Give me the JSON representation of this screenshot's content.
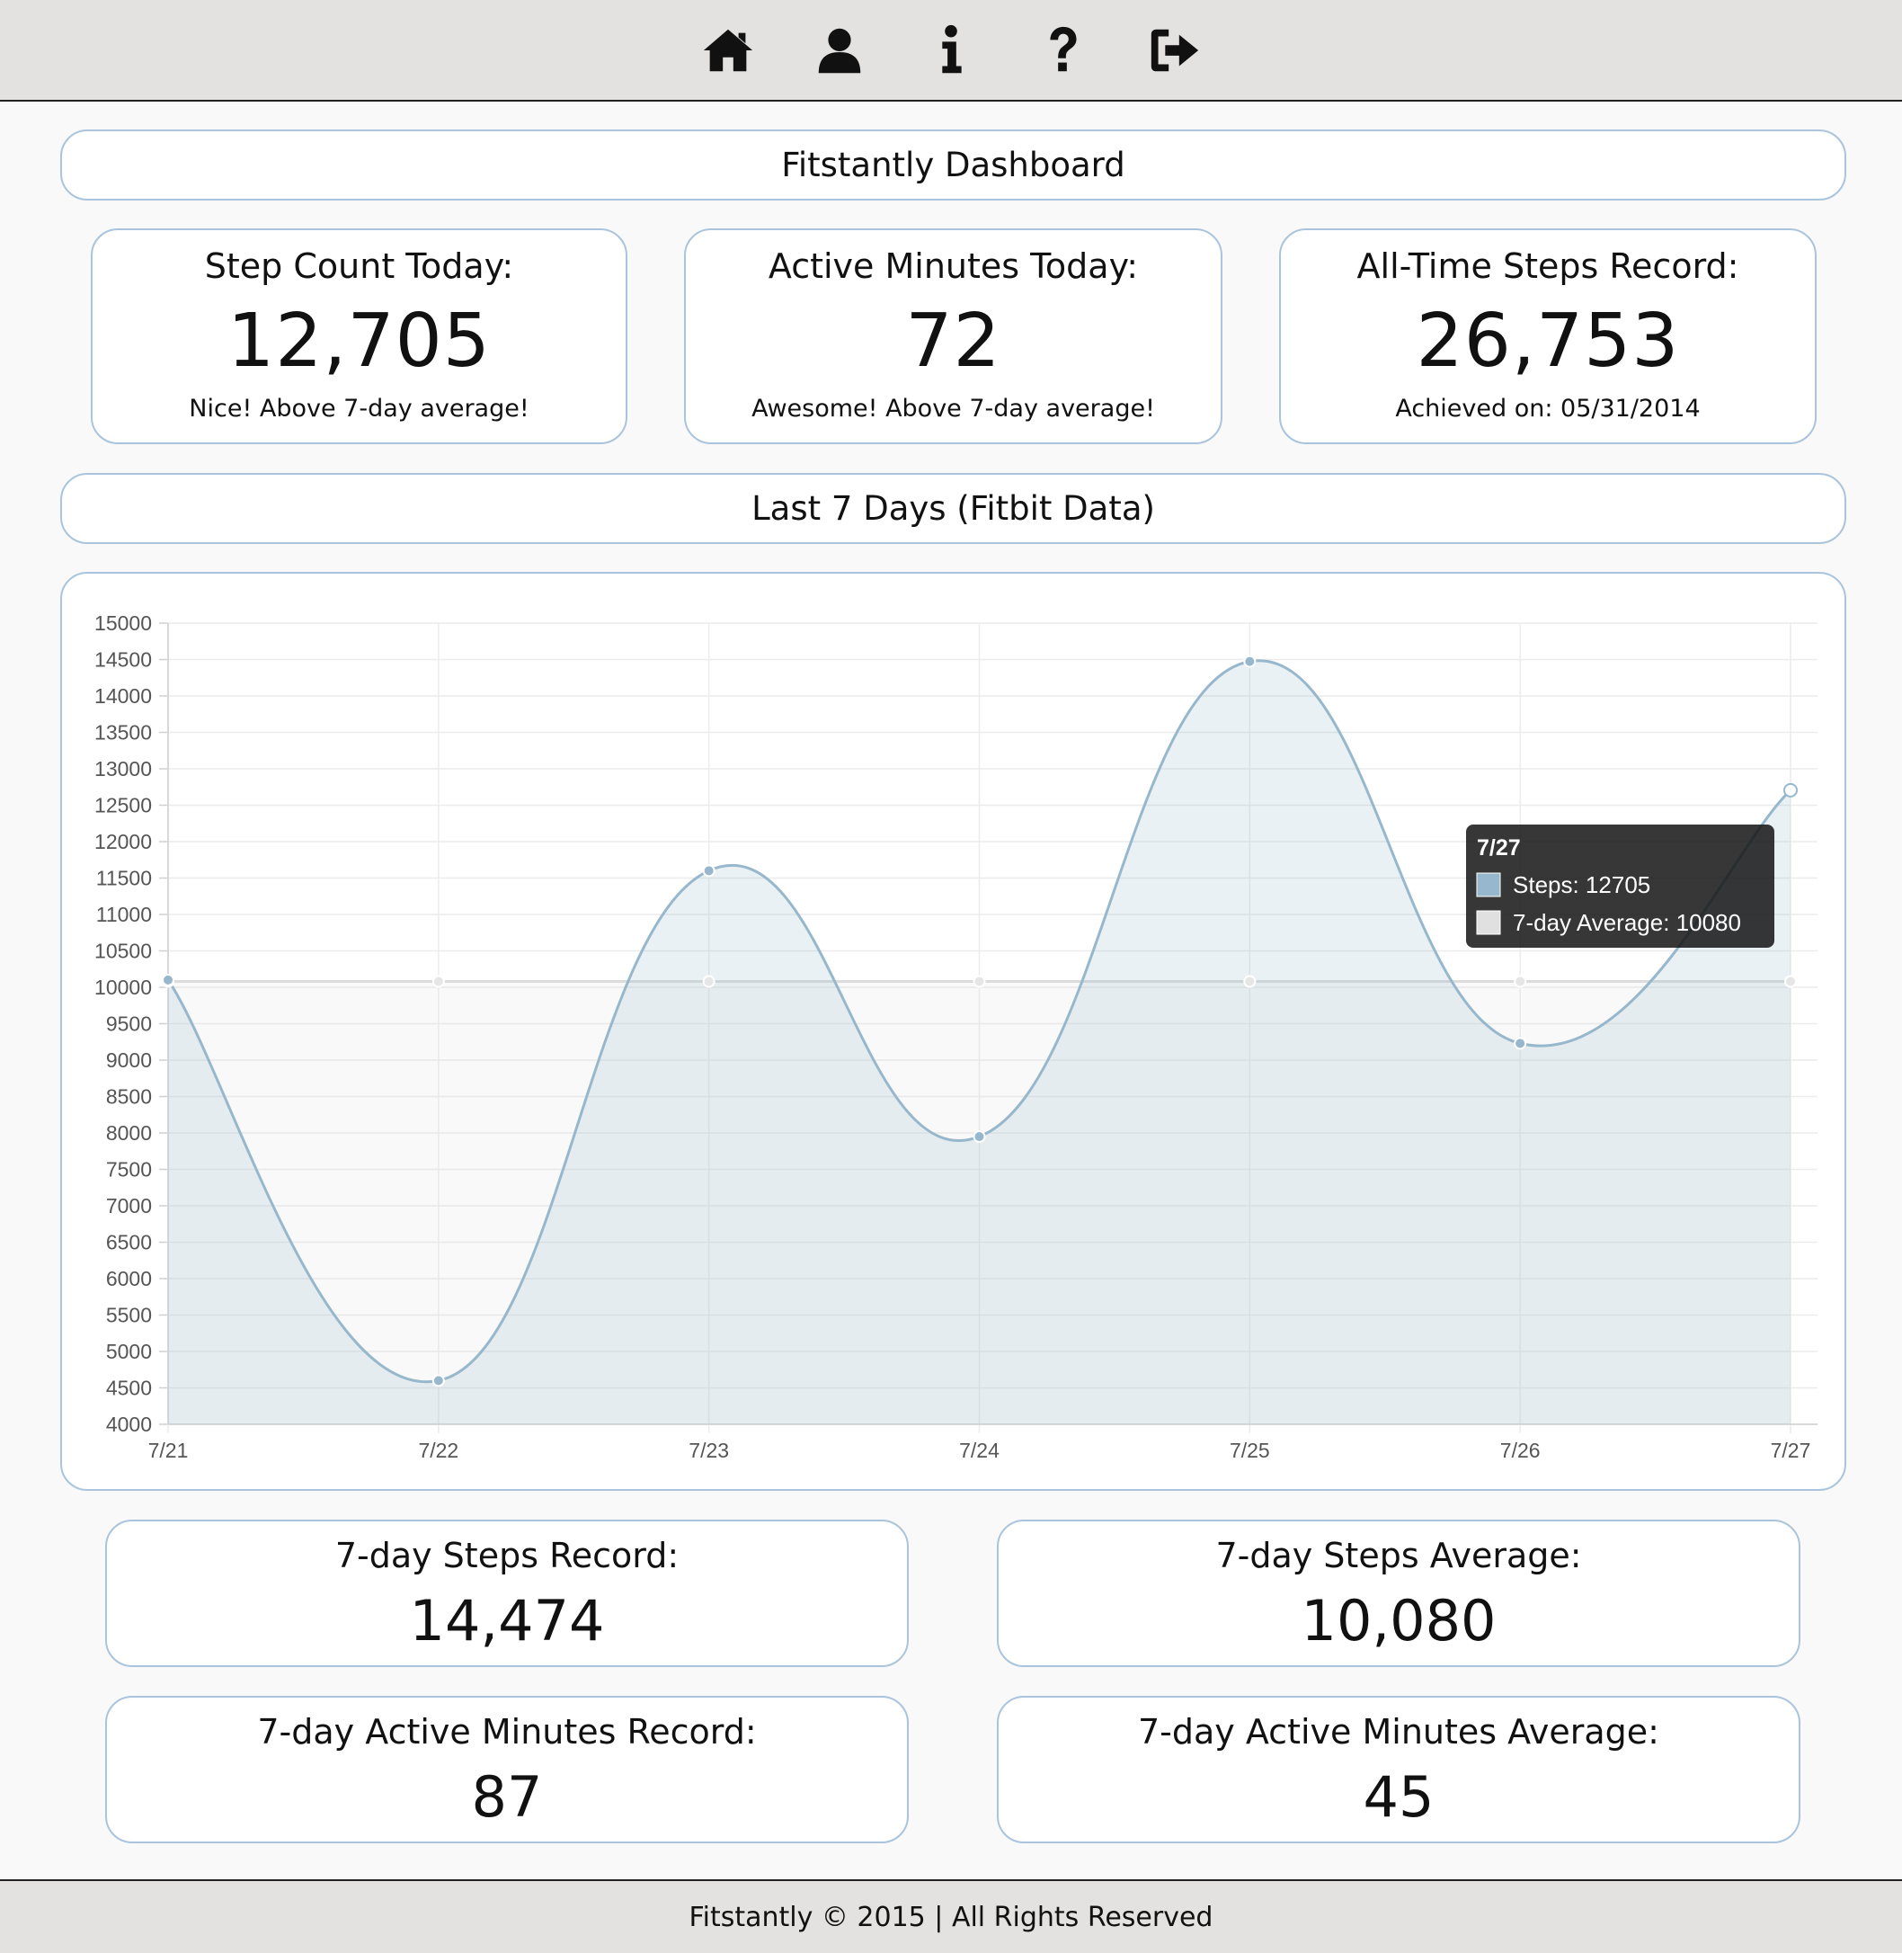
{
  "nav": {
    "icons": [
      "home-icon",
      "user-icon",
      "info-icon",
      "help-icon",
      "logout-icon"
    ]
  },
  "dashboard": {
    "title": "Fitstantly Dashboard"
  },
  "stats": [
    {
      "title": "Step Count Today:",
      "value": "12,705",
      "note": "Nice! Above 7-day average!"
    },
    {
      "title": "Active Minutes Today:",
      "value": "72",
      "note": "Awesome! Above 7-day average!"
    },
    {
      "title": "All-Time Steps Record:",
      "value": "26,753",
      "note": "Achieved on: 05/31/2014"
    }
  ],
  "chart_section": {
    "title": "Last 7 Days (Fitbit Data)"
  },
  "chart_data": {
    "type": "area",
    "categories": [
      "7/21",
      "7/22",
      "7/23",
      "7/24",
      "7/25",
      "7/26",
      "7/27"
    ],
    "series": [
      {
        "name": "Steps",
        "values": [
          10100,
          4600,
          11600,
          7950,
          14474,
          9230,
          12705
        ],
        "color": "#97b8cc"
      },
      {
        "name": "7-day Average",
        "values": [
          10080,
          10080,
          10080,
          10080,
          10080,
          10080,
          10080
        ],
        "color": "#dcdcdc"
      }
    ],
    "ylim": [
      4000,
      15000
    ],
    "yticks": [
      4000,
      4500,
      5000,
      5500,
      6000,
      6500,
      7000,
      7500,
      8000,
      8500,
      9000,
      9500,
      10000,
      10500,
      11000,
      11500,
      12000,
      12500,
      13000,
      13500,
      14000,
      14500,
      15000
    ],
    "grid": true,
    "tooltip": {
      "title": "7/27",
      "lines": [
        "Steps: 12705",
        "7-day Average: 10080"
      ]
    }
  },
  "weekly": [
    {
      "title": "7-day Steps Record:",
      "value": "14,474"
    },
    {
      "title": "7-day Steps Average:",
      "value": "10,080"
    },
    {
      "title": "7-day Active Minutes Record:",
      "value": "87"
    },
    {
      "title": "7-day Active Minutes Average:",
      "value": "45"
    }
  ],
  "footer": {
    "text": "Fitstantly © 2015 | All Rights Reserved"
  }
}
